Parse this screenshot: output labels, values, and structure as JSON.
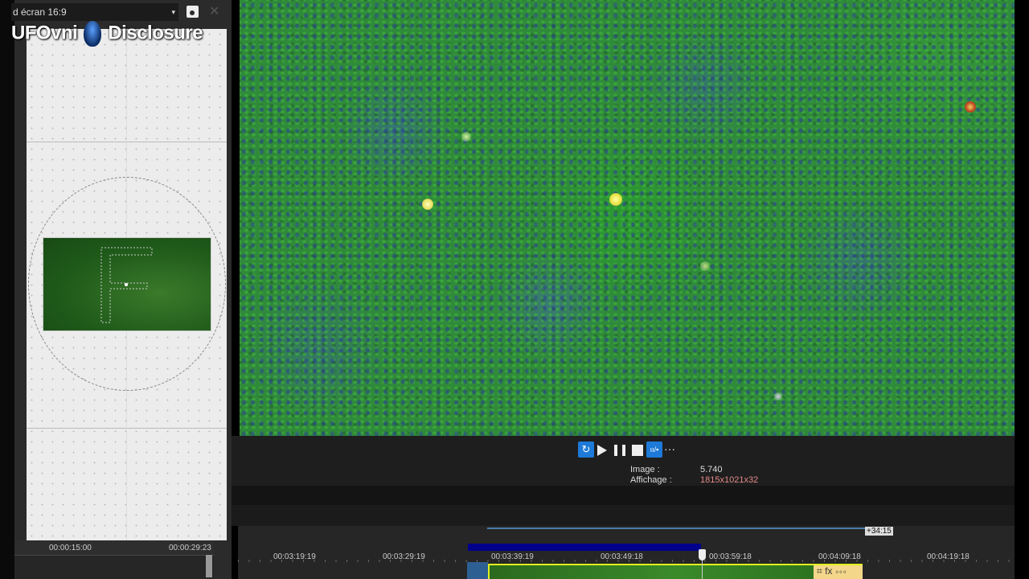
{
  "left_panel": {
    "preset_value": "d écran 16:9",
    "watermark": "UFOvni Disclosure",
    "watermark_left": "UFOvni",
    "watermark_right": "Disclosure",
    "ruler_labels": [
      "00:00:15:00",
      "00:00:29:23"
    ]
  },
  "transport": {
    "loop_label": "↻",
    "split_label": "ıı/▪",
    "more_label": "···"
  },
  "info": {
    "image_label": "Image :",
    "image_value": "5.740",
    "display_label": "Affichage :",
    "display_value": "1815x1021x32"
  },
  "timeline": {
    "offset_badge": "+34:15",
    "timecodes": [
      "00:03:19:19",
      "00:03:29:19",
      "00:03:39:19",
      "00:03:49:18",
      "00:03:59:18",
      "00:04:09:18",
      "00:04:19:18"
    ],
    "clip_fx_label": "⌗ fx ∘∘∘"
  },
  "colors": {
    "accent": "#1e7ad8",
    "loop_region": "#00008a",
    "clip_border": "#e0f020",
    "display_value": "#e58a8a"
  }
}
